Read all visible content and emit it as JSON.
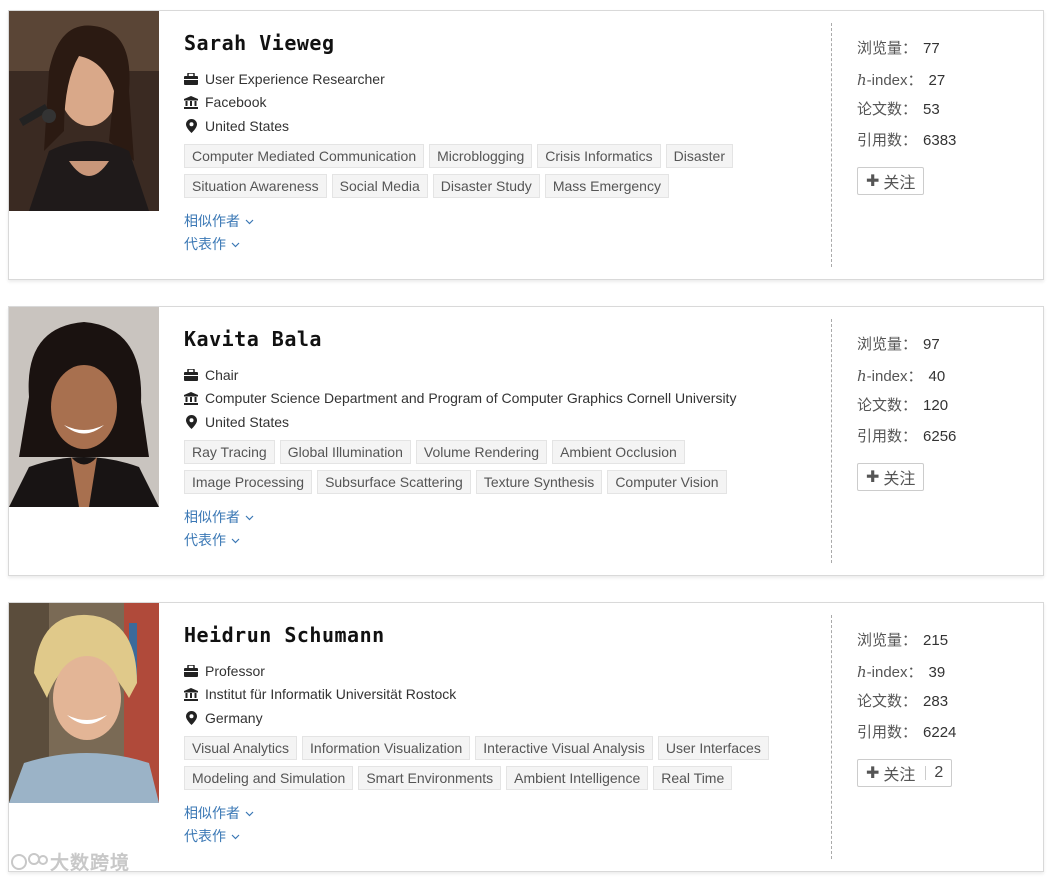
{
  "authors": [
    {
      "name": "Sarah Vieweg",
      "position": "User Experience Researcher",
      "affiliation": "Facebook",
      "location": "United States",
      "tags": [
        "Computer Mediated Communication",
        "Microblogging",
        "Crisis Informatics",
        "Disaster",
        "Situation Awareness",
        "Social Media",
        "Disaster Study",
        "Mass Emergency"
      ],
      "similar_authors_label": "相似作者",
      "representative_works_label": "代表作",
      "stats": {
        "views_label": "浏览量：",
        "views": "77",
        "hindex_prefix": "h",
        "hindex_suffix": "-index：",
        "hindex": "27",
        "papers_label": "论文数：",
        "papers": "53",
        "citations_label": "引用数：",
        "citations": "6383"
      },
      "follow_label": "关注",
      "follow_count": ""
    },
    {
      "name": "Kavita Bala",
      "position": "Chair",
      "affiliation": "Computer Science Department and Program of Computer Graphics Cornell University",
      "location": "United States",
      "tags": [
        "Ray Tracing",
        "Global Illumination",
        "Volume Rendering",
        "Ambient Occlusion",
        "Image Processing",
        "Subsurface Scattering",
        "Texture Synthesis",
        "Computer Vision"
      ],
      "similar_authors_label": "相似作者",
      "representative_works_label": "代表作",
      "stats": {
        "views_label": "浏览量：",
        "views": "97",
        "hindex_prefix": "h",
        "hindex_suffix": "-index：",
        "hindex": "40",
        "papers_label": "论文数：",
        "papers": "120",
        "citations_label": "引用数：",
        "citations": "6256"
      },
      "follow_label": "关注",
      "follow_count": ""
    },
    {
      "name": "Heidrun Schumann",
      "position": "Professor",
      "affiliation": "Institut für Informatik Universität Rostock",
      "location": "Germany",
      "tags": [
        "Visual Analytics",
        "Information Visualization",
        "Interactive Visual Analysis",
        "User Interfaces",
        "Modeling and Simulation",
        "Smart Environments",
        "Ambient Intelligence",
        "Real Time"
      ],
      "similar_authors_label": "相似作者",
      "representative_works_label": "代表作",
      "stats": {
        "views_label": "浏览量：",
        "views": "215",
        "hindex_prefix": "h",
        "hindex_suffix": "-index：",
        "hindex": "39",
        "papers_label": "论文数：",
        "papers": "283",
        "citations_label": "引用数：",
        "citations": "6224"
      },
      "follow_label": "关注",
      "follow_count": "2"
    }
  ],
  "watermark": "大数跨境",
  "colors": {
    "link": "#3b78b5",
    "tag_bg": "#f4f4f4",
    "border": "#d9d9d9"
  }
}
